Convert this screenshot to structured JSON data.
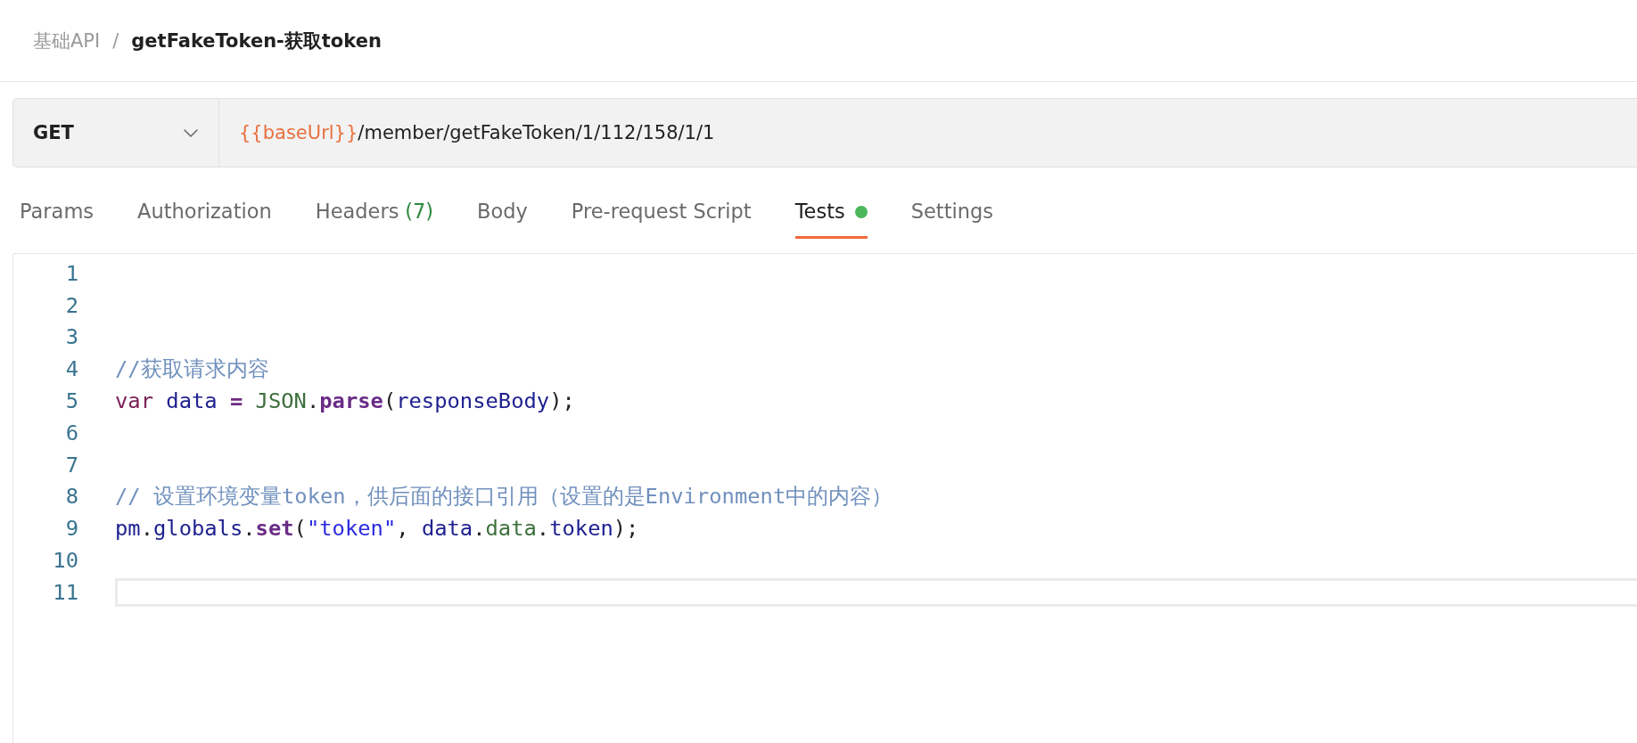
{
  "breadcrumb": {
    "items": [
      {
        "label": "基础API",
        "current": false
      },
      {
        "label": "getFakeToken-获取token",
        "current": true
      }
    ],
    "separator": "/"
  },
  "request": {
    "method": "GET",
    "url": [
      {
        "kind": "variable",
        "text": "{{baseUrl}}"
      },
      {
        "kind": "path",
        "text": "/member/getFakeToken/1/112/158/1/1"
      }
    ]
  },
  "tabs": [
    {
      "label": "Params",
      "selected": false,
      "indicator": false
    },
    {
      "label": "Authorization",
      "selected": false,
      "indicator": false
    },
    {
      "label": "Headers",
      "count": "(7)",
      "selected": false,
      "indicator": false
    },
    {
      "label": "Body",
      "selected": false,
      "indicator": false
    },
    {
      "label": "Pre-request Script",
      "selected": false,
      "indicator": false
    },
    {
      "label": "Tests",
      "selected": true,
      "indicator": true
    },
    {
      "label": "Settings",
      "selected": false,
      "indicator": false
    }
  ],
  "editor": {
    "lines": [
      {
        "number": "1",
        "current": false
      },
      {
        "number": "2",
        "current": false
      },
      {
        "number": "3",
        "current": false
      },
      {
        "number": "4",
        "current": false,
        "tokens": [
          {
            "kind": "comment",
            "text": "//获取请求内容"
          }
        ]
      },
      {
        "number": "5",
        "current": false,
        "tokens": [
          {
            "kind": "keyword",
            "text": "var"
          },
          {
            "kind": "variable",
            "text": " data"
          },
          {
            "kind": "operator",
            "text": " = "
          },
          {
            "kind": "class",
            "text": "JSON"
          },
          {
            "kind": "plain",
            "text": "."
          },
          {
            "kind": "method",
            "text": "parse"
          },
          {
            "kind": "plain",
            "text": "("
          },
          {
            "kind": "variable",
            "text": "responseBody"
          },
          {
            "kind": "plain",
            "text": ");"
          }
        ]
      },
      {
        "number": "6",
        "current": false
      },
      {
        "number": "7",
        "current": false
      },
      {
        "number": "8",
        "current": false,
        "tokens": [
          {
            "kind": "comment",
            "text": "// 设置环境变量token，供后面的接口引用（设置的是Environment中的内容）"
          }
        ]
      },
      {
        "number": "9",
        "current": false,
        "tokens": [
          {
            "kind": "variable",
            "text": "pm"
          },
          {
            "kind": "plain",
            "text": "."
          },
          {
            "kind": "variable",
            "text": "globals"
          },
          {
            "kind": "plain",
            "text": "."
          },
          {
            "kind": "method",
            "text": "set"
          },
          {
            "kind": "plain",
            "text": "("
          },
          {
            "kind": "string",
            "text": "\"token\""
          },
          {
            "kind": "plain",
            "text": ", "
          },
          {
            "kind": "variable",
            "text": "data"
          },
          {
            "kind": "plain",
            "text": "."
          },
          {
            "kind": "property",
            "text": "data"
          },
          {
            "kind": "plain",
            "text": "."
          },
          {
            "kind": "variable",
            "text": "token"
          },
          {
            "kind": "plain",
            "text": ");"
          }
        ]
      },
      {
        "number": "10",
        "current": false
      },
      {
        "number": "11",
        "current": true
      }
    ]
  }
}
